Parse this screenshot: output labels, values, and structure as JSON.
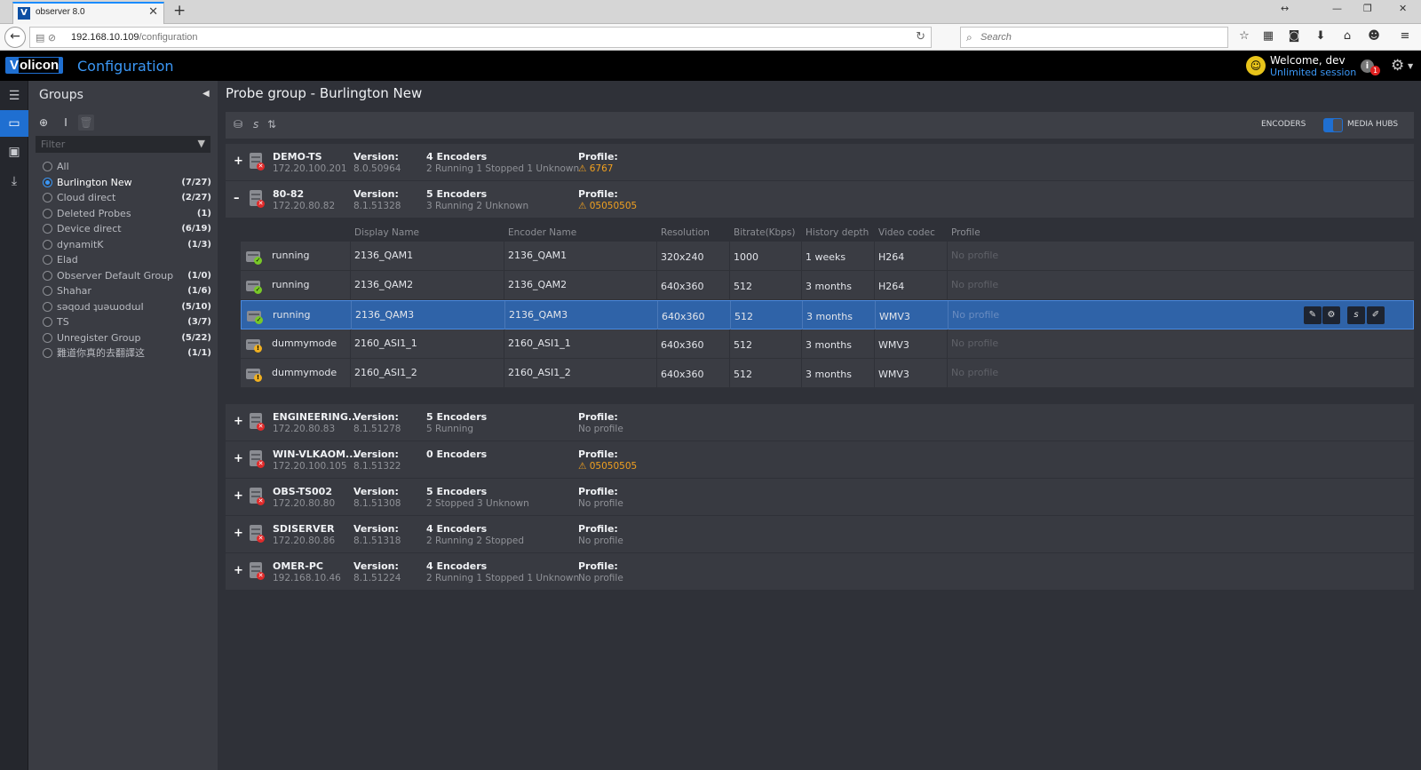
{
  "browser": {
    "tab_title": "observer 8.0",
    "tab_favicon": "V",
    "url_host": "192.168.10.109",
    "url_path": "/configuration",
    "search_placeholder": "Search"
  },
  "app": {
    "logo_v": "V",
    "logo_rest": "olicon",
    "title": "Configuration",
    "welcome": "Welcome, dev",
    "session": "Unlimited session",
    "notification_count": "1"
  },
  "groups": {
    "title": "Groups",
    "filter_placeholder": "Filter",
    "items": [
      {
        "name": "All",
        "count": "",
        "checked": false
      },
      {
        "name": "Burlington New",
        "count": "(7/27)",
        "checked": true
      },
      {
        "name": "Cloud direct",
        "count": "(2/27)",
        "checked": false
      },
      {
        "name": "Deleted Probes",
        "count": "(1)",
        "checked": false
      },
      {
        "name": "Device direct",
        "count": "(6/19)",
        "checked": false
      },
      {
        "name": "dynamitK",
        "count": "(1/3)",
        "checked": false
      },
      {
        "name": "Elad",
        "count": "",
        "checked": false
      },
      {
        "name": "Observer Default Group",
        "count": "(1/0)",
        "checked": false
      },
      {
        "name": "Shahar",
        "count": "(1/6)",
        "checked": false
      },
      {
        "name": "sǝqoɹd ʇuǝɯodɯI",
        "count": "(5/10)",
        "checked": false
      },
      {
        "name": "TS",
        "count": "(3/7)",
        "checked": false
      },
      {
        "name": "Unregister Group",
        "count": "(5/22)",
        "checked": false
      },
      {
        "name": "難道你真的去翻譯这",
        "count": "(1/1)",
        "checked": false
      }
    ]
  },
  "main": {
    "page_title": "Probe group - Burlington New",
    "toggle_left": "ENCODERS",
    "toggle_right": "MEDIA HUBS",
    "version_label": "Version:",
    "profile_label": "Profile:",
    "probes_top": [
      {
        "toggle": "+",
        "name": "DEMO-TS",
        "ip": "172.20.100.201",
        "version": "8.0.50964",
        "encoders": "4 Encoders",
        "status": "2 Running 1 Stopped 1 Unknown",
        "profile": "⚠ 6767",
        "profile_warn": true
      },
      {
        "toggle": "–",
        "name": "80-82",
        "ip": "172.20.80.82",
        "version": "8.1.51328",
        "encoders": "5 Encoders",
        "status": "3 Running 2 Unknown",
        "profile": "⚠ 05050505",
        "profile_warn": true
      }
    ],
    "encoder_headers": [
      "Display Name",
      "Encoder Name",
      "Resolution",
      "Bitrate(Kbps)",
      "History depth",
      "Video codec",
      "Profile"
    ],
    "encoders": [
      {
        "state": "running",
        "status_icon": "ok",
        "display": "2136_QAM1",
        "encoder": "2136_QAM1",
        "resolution": "320x240",
        "bitrate": "1000",
        "history": "1 weeks",
        "codec": "H264",
        "profile": "No profile"
      },
      {
        "state": "running",
        "status_icon": "ok",
        "display": "2136_QAM2",
        "encoder": "2136_QAM2",
        "resolution": "640x360",
        "bitrate": "512",
        "history": "3 months",
        "codec": "H264",
        "profile": "No profile"
      },
      {
        "state": "running",
        "status_icon": "ok",
        "display": "2136_QAM3",
        "encoder": "2136_QAM3",
        "resolution": "640x360",
        "bitrate": "512",
        "history": "3 months",
        "codec": "WMV3",
        "profile": "No profile",
        "selected": true
      },
      {
        "state": "dummymode",
        "status_icon": "warn",
        "display": "2160_ASI1_1",
        "encoder": "2160_ASI1_1",
        "resolution": "640x360",
        "bitrate": "512",
        "history": "3 months",
        "codec": "WMV3",
        "profile": "No profile"
      },
      {
        "state": "dummymode",
        "status_icon": "warn",
        "display": "2160_ASI1_2",
        "encoder": "2160_ASI1_2",
        "resolution": "640x360",
        "bitrate": "512",
        "history": "3 months",
        "codec": "WMV3",
        "profile": "No profile"
      }
    ],
    "probes_bottom": [
      {
        "toggle": "+",
        "name": "ENGINEERING...",
        "ip": "172.20.80.83",
        "version": "8.1.51278",
        "encoders": "5 Encoders",
        "status": "5 Running",
        "profile": "No profile",
        "profile_warn": false
      },
      {
        "toggle": "+",
        "name": "WIN-VLKAOM...",
        "ip": "172.20.100.105",
        "version": "8.1.51322",
        "encoders": "0 Encoders",
        "status": "",
        "profile": "⚠ 05050505",
        "profile_warn": true
      },
      {
        "toggle": "+",
        "name": "OBS-TS002",
        "ip": "172.20.80.80",
        "version": "8.1.51308",
        "encoders": "5 Encoders",
        "status": "2 Stopped 3 Unknown",
        "profile": "No profile",
        "profile_warn": false
      },
      {
        "toggle": "+",
        "name": "SDISERVER",
        "ip": "172.20.80.86",
        "version": "8.1.51318",
        "encoders": "4 Encoders",
        "status": "2 Running 2 Stopped",
        "profile": "No profile",
        "profile_warn": false
      },
      {
        "toggle": "+",
        "name": "OMER-PC",
        "ip": "192.168.10.46",
        "version": "8.1.51224",
        "encoders": "4 Encoders",
        "status": "2 Running 1 Stopped 1 Unknown",
        "profile": "No profile",
        "profile_warn": false
      }
    ]
  }
}
